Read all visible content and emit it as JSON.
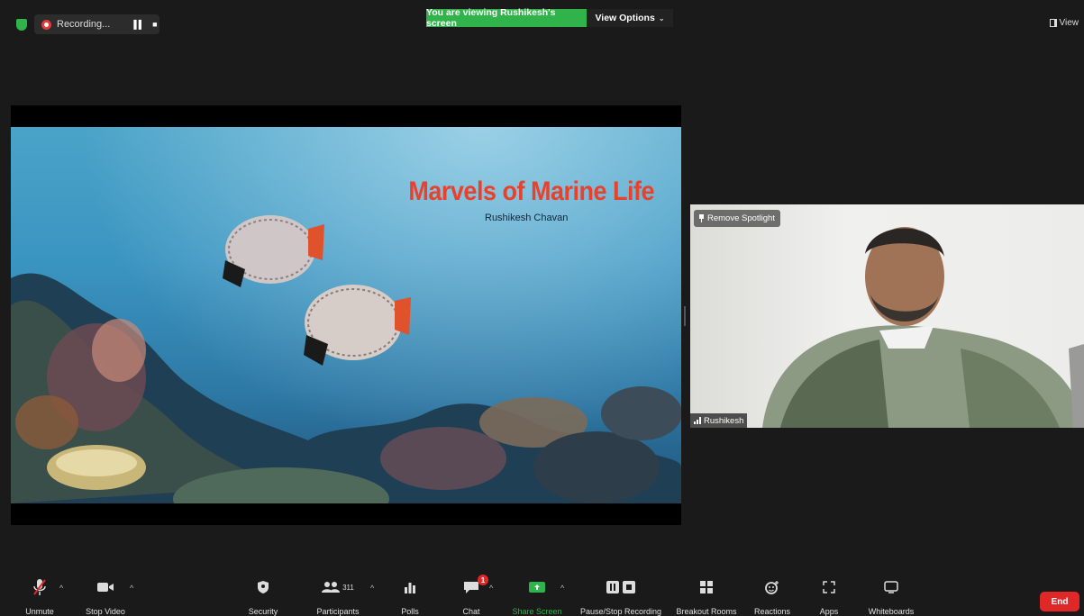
{
  "top": {
    "recording_label": "Recording...",
    "viewing_banner": "You are viewing Rushikesh's screen",
    "view_options": "View Options",
    "view_label": "View"
  },
  "slide": {
    "title": "Marvels of Marine Life",
    "subtitle": "Rushikesh Chavan"
  },
  "video": {
    "spotlight_label": "Remove Spotlight",
    "participant_name": "Rushikesh"
  },
  "toolbar": {
    "unmute": "Unmute",
    "stop_video": "Stop Video",
    "security": "Security",
    "participants": "Participants",
    "participants_count": "311",
    "polls": "Polls",
    "chat": "Chat",
    "chat_badge": "1",
    "share_screen": "Share Screen",
    "pause_recording": "Pause/Stop Recording",
    "breakout_rooms": "Breakout Rooms",
    "reactions": "Reactions",
    "apps": "Apps",
    "whiteboards": "Whiteboards",
    "end": "End"
  },
  "colors": {
    "accent_green": "#2fb34a",
    "end_red": "#e02828",
    "title_red": "#e8412c"
  }
}
